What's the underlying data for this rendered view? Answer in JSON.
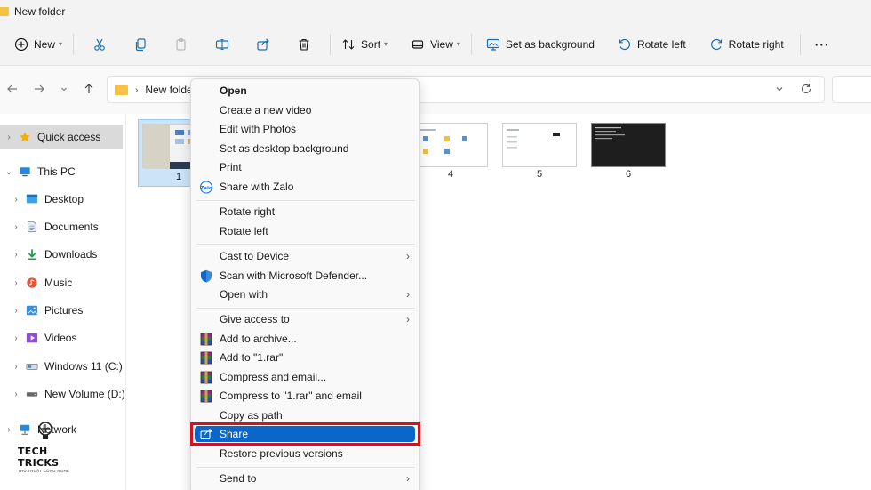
{
  "window": {
    "title": "New folder"
  },
  "toolbar": {
    "new_label": "New",
    "sort_label": "Sort",
    "view_label": "View",
    "set_bg_label": "Set as background",
    "rotate_left_label": "Rotate left",
    "rotate_right_label": "Rotate right",
    "more_label": "···"
  },
  "address": {
    "path": "New folde"
  },
  "sidebar": {
    "items": [
      {
        "label": "Quick access",
        "icon": "star-icon",
        "color": "#f3b200"
      },
      {
        "label": "This PC",
        "icon": "monitor-icon",
        "color": "#2b88d8"
      },
      {
        "label": "Desktop",
        "icon": "desktop-folder-icon",
        "color": "#3aa0e8"
      },
      {
        "label": "Documents",
        "icon": "documents-icon",
        "color": "#7a8aa0"
      },
      {
        "label": "Downloads",
        "icon": "downloads-icon",
        "color": "#1f9b4a"
      },
      {
        "label": "Music",
        "icon": "music-icon",
        "color": "#e0583c"
      },
      {
        "label": "Pictures",
        "icon": "pictures-icon",
        "color": "#3a8fd8"
      },
      {
        "label": "Videos",
        "icon": "videos-icon",
        "color": "#8b4fd0"
      },
      {
        "label": "Windows 11 (C:)",
        "icon": "drive-icon",
        "color": "#6a7a90"
      },
      {
        "label": "New Volume (D:)",
        "icon": "drive-icon",
        "color": "#555555"
      },
      {
        "label": "Network",
        "icon": "network-icon",
        "color": "#2b88d8"
      }
    ]
  },
  "files": [
    {
      "label": "1"
    },
    {
      "label": "4"
    },
    {
      "label": "5"
    },
    {
      "label": "6"
    }
  ],
  "context_menu": {
    "items": [
      {
        "label": "Open"
      },
      {
        "label": "Create a new video"
      },
      {
        "label": "Edit with Photos"
      },
      {
        "label": "Set as desktop background"
      },
      {
        "label": "Print"
      },
      {
        "label": "Share with Zalo",
        "icon": "zalo-icon"
      },
      {
        "label": "Rotate right"
      },
      {
        "label": "Rotate left"
      },
      {
        "label": "Cast to Device"
      },
      {
        "label": "Scan with Microsoft Defender...",
        "icon": "defender-shield-icon"
      },
      {
        "label": "Open with"
      },
      {
        "label": "Give access to"
      },
      {
        "label": "Add to archive...",
        "icon": "winrar-icon"
      },
      {
        "label": "Add to \"1.rar\"",
        "icon": "winrar-icon"
      },
      {
        "label": "Compress and email...",
        "icon": "winrar-icon"
      },
      {
        "label": "Compress to \"1.rar\" and email",
        "icon": "winrar-icon"
      },
      {
        "label": "Copy as path"
      },
      {
        "label": "Share",
        "icon": "share-icon"
      },
      {
        "label": "Restore previous versions"
      },
      {
        "label": "Send to"
      }
    ],
    "arrow": "›"
  },
  "watermark": {
    "title": "TECH TRICKS",
    "subtitle": "THỦ THUẬT CÔNG NGHỆ"
  },
  "colors": {
    "accent": "#0a67c9",
    "highlight_border": "#d0141f",
    "selection": "#cce4f7"
  }
}
